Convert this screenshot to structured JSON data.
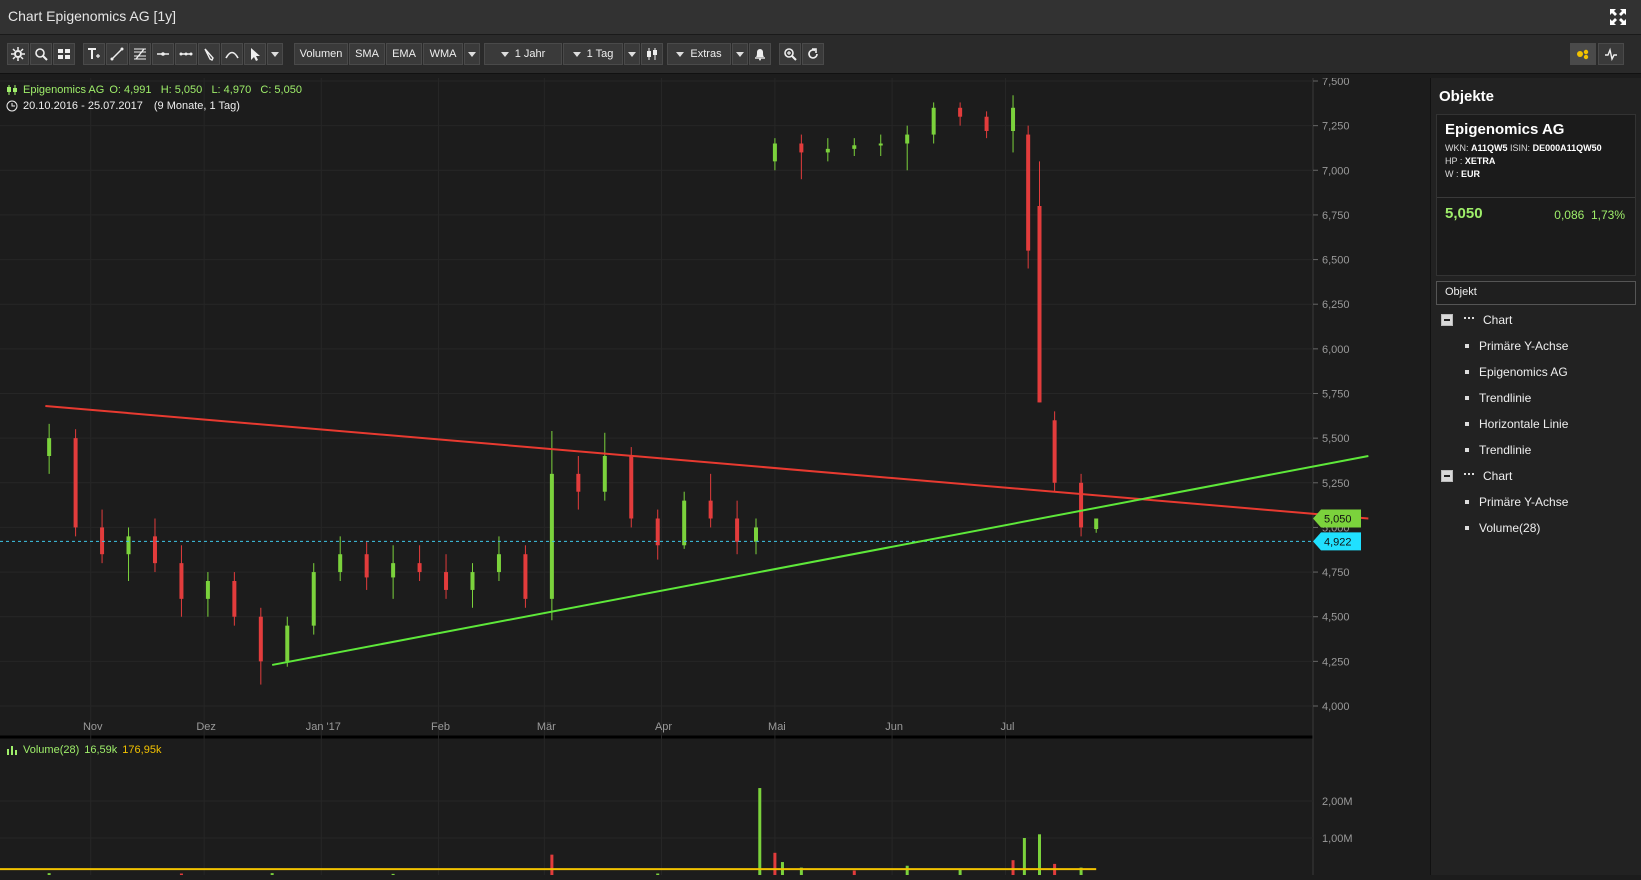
{
  "window": {
    "title": "Chart Epigenomics AG [1y]"
  },
  "toolbar": {
    "buttons": {
      "volumen": "Volumen",
      "sma": "SMA",
      "ema": "EMA",
      "wma": "WMA",
      "period": "1 Jahr",
      "interval": "1 Tag",
      "extras": "Extras"
    },
    "icons": [
      "settings-icon",
      "search-icon",
      "grid-icon",
      "text-tool-icon",
      "line-tool-icon",
      "fibonacci-icon",
      "horizontal-line-icon",
      "channel-icon",
      "pen-icon",
      "arc-icon",
      "cursor-icon",
      "zoom-in-icon",
      "reset-icon",
      "bell-icon",
      "candlestick-icon",
      "toggle-icon",
      "pulse-icon"
    ]
  },
  "legend": {
    "name": "Epigenomics AG",
    "ohlc": "O: 4,991   H: 5,050   L: 4,970   C: 5,050",
    "range": "20.10.2016 - 25.07.2017",
    "range_duration": "(9 Monate, 1 Tag)"
  },
  "volume_legend": {
    "label": "Volume(28)",
    "v1": "16,59k",
    "v2": "176,95k"
  },
  "price_labels": {
    "last": "5,050",
    "line": "4,922",
    "hidden": "5,000"
  },
  "colors": {
    "up": "#7bd23c",
    "down": "#e23c3c",
    "trend_red": "#e83a30",
    "trend_green": "#5ee83a",
    "hline": "#3ec6e8",
    "accent_green": "#9fef6a"
  },
  "sidebar": {
    "title": "Objekte",
    "card": {
      "name": "Epigenomics AG",
      "wkn_label": "WKN:",
      "wkn": "A11QW5",
      "isin_label": "ISIN:",
      "isin": "DE000A11QW50",
      "hp_label": "HP :",
      "hp": "XETRA",
      "w_label": "W :",
      "w": "EUR",
      "price": "5,050",
      "change": "0,086",
      "change_pct": "1,73%"
    },
    "object_box": "Objekt",
    "tree": [
      {
        "label": "Chart",
        "level": 0
      },
      {
        "label": "Primäre Y-Achse",
        "level": 1
      },
      {
        "label": "Epigenomics AG",
        "level": 1
      },
      {
        "label": "Trendlinie",
        "level": 1
      },
      {
        "label": "Horizontale Linie",
        "level": 1
      },
      {
        "label": "Trendlinie",
        "level": 1
      },
      {
        "label": "Chart",
        "level": 0
      },
      {
        "label": "Primäre Y-Achse",
        "level": 1
      },
      {
        "label": "Volume(28)",
        "level": 1
      }
    ]
  },
  "chart_data": {
    "type": "candlestick",
    "title": "Epigenomics AG",
    "y_axis": {
      "min": 4.0,
      "max": 7.5,
      "ticks": [
        "7,500",
        "7,250",
        "7,000",
        "6,750",
        "6,500",
        "6,250",
        "6,000",
        "5,750",
        "5,500",
        "5,250",
        "5,000",
        "4,750",
        "4,500",
        "4,250",
        "4,000"
      ]
    },
    "x_axis": {
      "ticks": [
        "Nov",
        "Dez",
        "Jan '17",
        "Feb",
        "Mär",
        "Apr",
        "Mai",
        "Jun",
        "Jul"
      ]
    },
    "horizontal_line": 4.922,
    "trendlines": [
      {
        "name": "Trendlinie",
        "color": "red",
        "start": {
          "date": "2016-10-20",
          "price": 5.68
        },
        "end": {
          "date": "2017-10-05",
          "price": 5.05
        }
      },
      {
        "name": "Trendlinie",
        "color": "green",
        "start": {
          "date": "2016-12-19",
          "price": 4.23
        },
        "end": {
          "date": "2017-10-05",
          "price": 5.4
        }
      }
    ],
    "ohlc": [
      {
        "date": "2016-10-21",
        "o": 5.4,
        "h": 5.58,
        "l": 5.3,
        "c": 5.5
      },
      {
        "date": "2016-10-28",
        "o": 5.5,
        "h": 5.55,
        "l": 4.95,
        "c": 5.0
      },
      {
        "date": "2016-11-04",
        "o": 5.0,
        "h": 5.1,
        "l": 4.8,
        "c": 4.85
      },
      {
        "date": "2016-11-11",
        "o": 4.85,
        "h": 5.0,
        "l": 4.7,
        "c": 4.95
      },
      {
        "date": "2016-11-18",
        "o": 4.95,
        "h": 5.05,
        "l": 4.75,
        "c": 4.8
      },
      {
        "date": "2016-11-25",
        "o": 4.8,
        "h": 4.9,
        "l": 4.5,
        "c": 4.6
      },
      {
        "date": "2016-12-02",
        "o": 4.6,
        "h": 4.75,
        "l": 4.5,
        "c": 4.7
      },
      {
        "date": "2016-12-09",
        "o": 4.7,
        "h": 4.75,
        "l": 4.45,
        "c": 4.5
      },
      {
        "date": "2016-12-16",
        "o": 4.5,
        "h": 4.55,
        "l": 4.12,
        "c": 4.25
      },
      {
        "date": "2016-12-23",
        "o": 4.25,
        "h": 4.5,
        "l": 4.22,
        "c": 4.45
      },
      {
        "date": "2016-12-30",
        "o": 4.45,
        "h": 4.8,
        "l": 4.4,
        "c": 4.75
      },
      {
        "date": "2017-01-06",
        "o": 4.75,
        "h": 4.95,
        "l": 4.7,
        "c": 4.85
      },
      {
        "date": "2017-01-13",
        "o": 4.85,
        "h": 4.92,
        "l": 4.65,
        "c": 4.72
      },
      {
        "date": "2017-01-20",
        "o": 4.72,
        "h": 4.9,
        "l": 4.6,
        "c": 4.8
      },
      {
        "date": "2017-01-27",
        "o": 4.8,
        "h": 4.9,
        "l": 4.7,
        "c": 4.75
      },
      {
        "date": "2017-02-03",
        "o": 4.75,
        "h": 4.85,
        "l": 4.6,
        "c": 4.65
      },
      {
        "date": "2017-02-10",
        "o": 4.65,
        "h": 4.8,
        "l": 4.55,
        "c": 4.75
      },
      {
        "date": "2017-02-17",
        "o": 4.75,
        "h": 4.95,
        "l": 4.7,
        "c": 4.85
      },
      {
        "date": "2017-02-24",
        "o": 4.85,
        "h": 4.9,
        "l": 4.55,
        "c": 4.6
      },
      {
        "date": "2017-03-03",
        "o": 4.6,
        "h": 5.54,
        "l": 4.48,
        "c": 5.3
      },
      {
        "date": "2017-03-10",
        "o": 5.3,
        "h": 5.4,
        "l": 5.1,
        "c": 5.2
      },
      {
        "date": "2017-03-17",
        "o": 5.2,
        "h": 5.53,
        "l": 5.15,
        "c": 5.4
      },
      {
        "date": "2017-03-24",
        "o": 5.4,
        "h": 5.45,
        "l": 5.0,
        "c": 5.05
      },
      {
        "date": "2017-03-31",
        "o": 5.05,
        "h": 5.1,
        "l": 4.82,
        "c": 4.9
      },
      {
        "date": "2017-04-07",
        "o": 4.9,
        "h": 5.2,
        "l": 4.88,
        "c": 5.15
      },
      {
        "date": "2017-04-14",
        "o": 5.15,
        "h": 5.3,
        "l": 5.0,
        "c": 5.05
      },
      {
        "date": "2017-04-21",
        "o": 5.05,
        "h": 5.15,
        "l": 4.85,
        "c": 4.92
      },
      {
        "date": "2017-04-26",
        "o": 4.92,
        "h": 5.05,
        "l": 4.85,
        "c": 5.0
      },
      {
        "date": "2017-05-01",
        "o": 7.05,
        "h": 7.18,
        "l": 7.0,
        "c": 7.15
      },
      {
        "date": "2017-05-08",
        "o": 7.15,
        "h": 7.2,
        "l": 6.95,
        "c": 7.1
      },
      {
        "date": "2017-05-15",
        "o": 7.1,
        "h": 7.18,
        "l": 7.05,
        "c": 7.12
      },
      {
        "date": "2017-05-22",
        "o": 7.12,
        "h": 7.18,
        "l": 7.08,
        "c": 7.14
      },
      {
        "date": "2017-05-29",
        "o": 7.14,
        "h": 7.2,
        "l": 7.08,
        "c": 7.15
      },
      {
        "date": "2017-06-05",
        "o": 7.15,
        "h": 7.25,
        "l": 7.0,
        "c": 7.2
      },
      {
        "date": "2017-06-12",
        "o": 7.2,
        "h": 7.38,
        "l": 7.15,
        "c": 7.35
      },
      {
        "date": "2017-06-19",
        "o": 7.35,
        "h": 7.38,
        "l": 7.25,
        "c": 7.3
      },
      {
        "date": "2017-06-26",
        "o": 7.3,
        "h": 7.33,
        "l": 7.18,
        "c": 7.22
      },
      {
        "date": "2017-07-03",
        "o": 7.22,
        "h": 7.42,
        "l": 7.1,
        "c": 7.35
      },
      {
        "date": "2017-07-07",
        "o": 7.2,
        "h": 7.25,
        "l": 6.45,
        "c": 6.55
      },
      {
        "date": "2017-07-10",
        "o": 6.8,
        "h": 7.05,
        "l": 5.7,
        "c": 5.7
      },
      {
        "date": "2017-07-14",
        "o": 5.6,
        "h": 5.65,
        "l": 5.2,
        "c": 5.25
      },
      {
        "date": "2017-07-21",
        "o": 5.25,
        "h": 5.3,
        "l": 4.95,
        "c": 5.0
      },
      {
        "date": "2017-07-25",
        "o": 4.991,
        "h": 5.05,
        "l": 4.97,
        "c": 5.05
      }
    ],
    "volume": {
      "y_axis": {
        "ticks": [
          "2,00M",
          "1,00M"
        ]
      },
      "bars": [
        {
          "date": "2016-10-21",
          "v": 0.05
        },
        {
          "date": "2016-11-25",
          "v": 0.04
        },
        {
          "date": "2016-12-19",
          "v": 0.05
        },
        {
          "date": "2017-01-20",
          "v": 0.03
        },
        {
          "date": "2017-03-03",
          "v": 0.55
        },
        {
          "date": "2017-03-31",
          "v": 0.04
        },
        {
          "date": "2017-04-27",
          "v": 2.35
        },
        {
          "date": "2017-05-01",
          "v": 0.6
        },
        {
          "date": "2017-05-03",
          "v": 0.35
        },
        {
          "date": "2017-05-08",
          "v": 0.2
        },
        {
          "date": "2017-05-22",
          "v": 0.12
        },
        {
          "date": "2017-06-05",
          "v": 0.25
        },
        {
          "date": "2017-06-19",
          "v": 0.15
        },
        {
          "date": "2017-07-03",
          "v": 0.4
        },
        {
          "date": "2017-07-06",
          "v": 1.0
        },
        {
          "date": "2017-07-10",
          "v": 1.1
        },
        {
          "date": "2017-07-14",
          "v": 0.3
        },
        {
          "date": "2017-07-21",
          "v": 0.2
        }
      ],
      "moving_average": 0.16
    }
  }
}
